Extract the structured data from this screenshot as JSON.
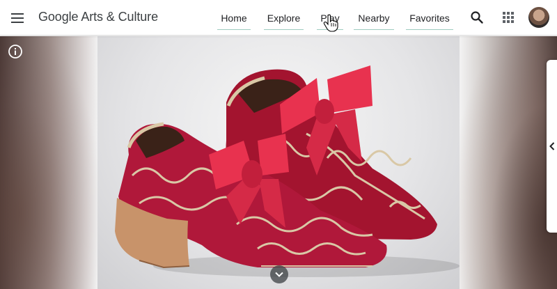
{
  "header": {
    "brand": "Google Arts & Culture",
    "nav": [
      {
        "label": "Home"
      },
      {
        "label": "Explore"
      },
      {
        "label": "Play"
      },
      {
        "label": "Nearby"
      },
      {
        "label": "Favorites"
      }
    ]
  },
  "icons": {
    "menu": "hamburger-menu-icon",
    "search": "search-icon",
    "apps": "apps-grid-icon",
    "info": "info-icon",
    "side_panel": "chevron-left-icon",
    "scroll_down": "chevron-down-icon"
  },
  "colors": {
    "nav_underline": "#9ecbc0",
    "text": "#202124",
    "velvet": "#b0183a",
    "ribbon": "#e8324f",
    "embroidery": "#d9c8a6"
  }
}
